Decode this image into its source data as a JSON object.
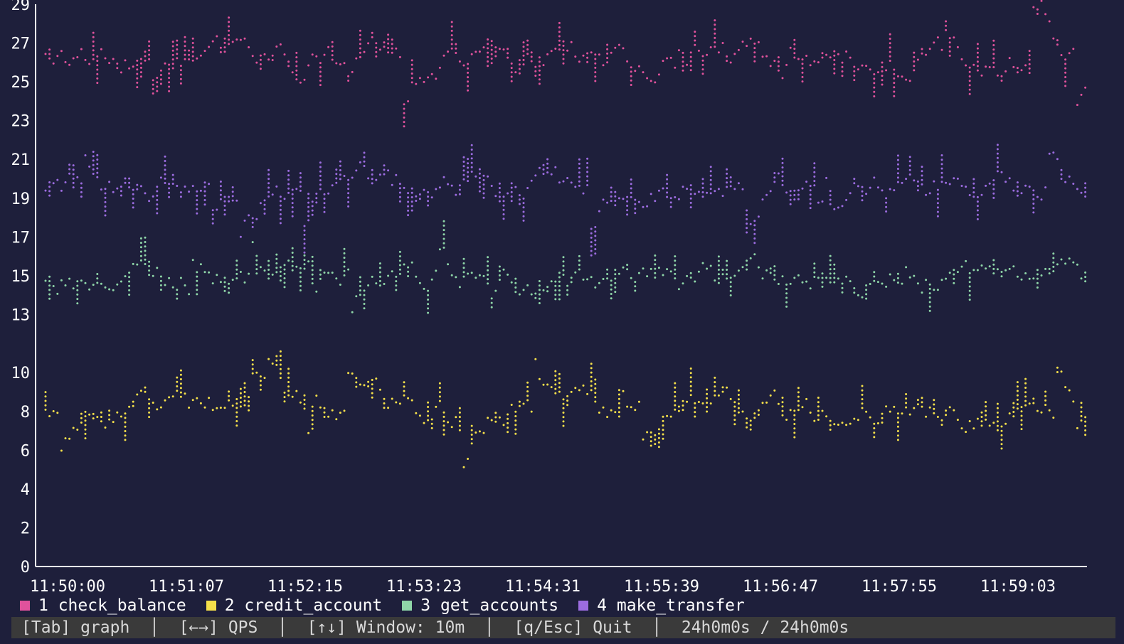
{
  "chart_data": {
    "type": "scatter",
    "title": "",
    "xlabel": "",
    "ylabel": "",
    "ylim": [
      0,
      29
    ],
    "y_ticks": [
      "0",
      "2",
      "4",
      "6",
      "8",
      "10",
      "13",
      "15",
      "17",
      "19",
      "21",
      "23",
      "25",
      "27",
      "29"
    ],
    "x_ticks": [
      "11:50:00",
      "11:51:07",
      "11:52:15",
      "11:53:23",
      "11:54:31",
      "11:55:39",
      "11:56:47",
      "11:57:55",
      "11:59:03"
    ],
    "x_range": [
      "11:50:00",
      "11:59:59"
    ],
    "grid": false,
    "legend_position": "bottom-left",
    "series": [
      {
        "name": "1 check_balance",
        "color": "#e0529c",
        "mean": 26.2,
        "min": 23.1,
        "max": 29.3
      },
      {
        "name": "2 credit_account",
        "color": "#f5e04a",
        "mean": 8.0,
        "min": 4.0,
        "max": 10.7
      },
      {
        "name": "3 get_accounts",
        "color": "#8fd6a8",
        "mean": 14.8,
        "min": 11.8,
        "max": 17.6
      },
      {
        "name": "4 make_transfer",
        "color": "#9c6ce0",
        "mean": 19.6,
        "min": 17.0,
        "max": 22.6
      }
    ]
  },
  "legend": {
    "items": [
      {
        "label": "1 check_balance",
        "color": "#e0529c"
      },
      {
        "label": "2 credit_account",
        "color": "#f5e04a"
      },
      {
        "label": "3 get_accounts",
        "color": "#8fd6a8"
      },
      {
        "label": "4 make_transfer",
        "color": "#9c6ce0"
      }
    ]
  },
  "statusbar": {
    "tab": "[Tab] graph",
    "qps": "[←→] QPS",
    "window": "[↑↓] Window: 10m",
    "quit": "[q/Esc] Quit",
    "elapsed": "24h0m0s / 24h0m0s"
  }
}
